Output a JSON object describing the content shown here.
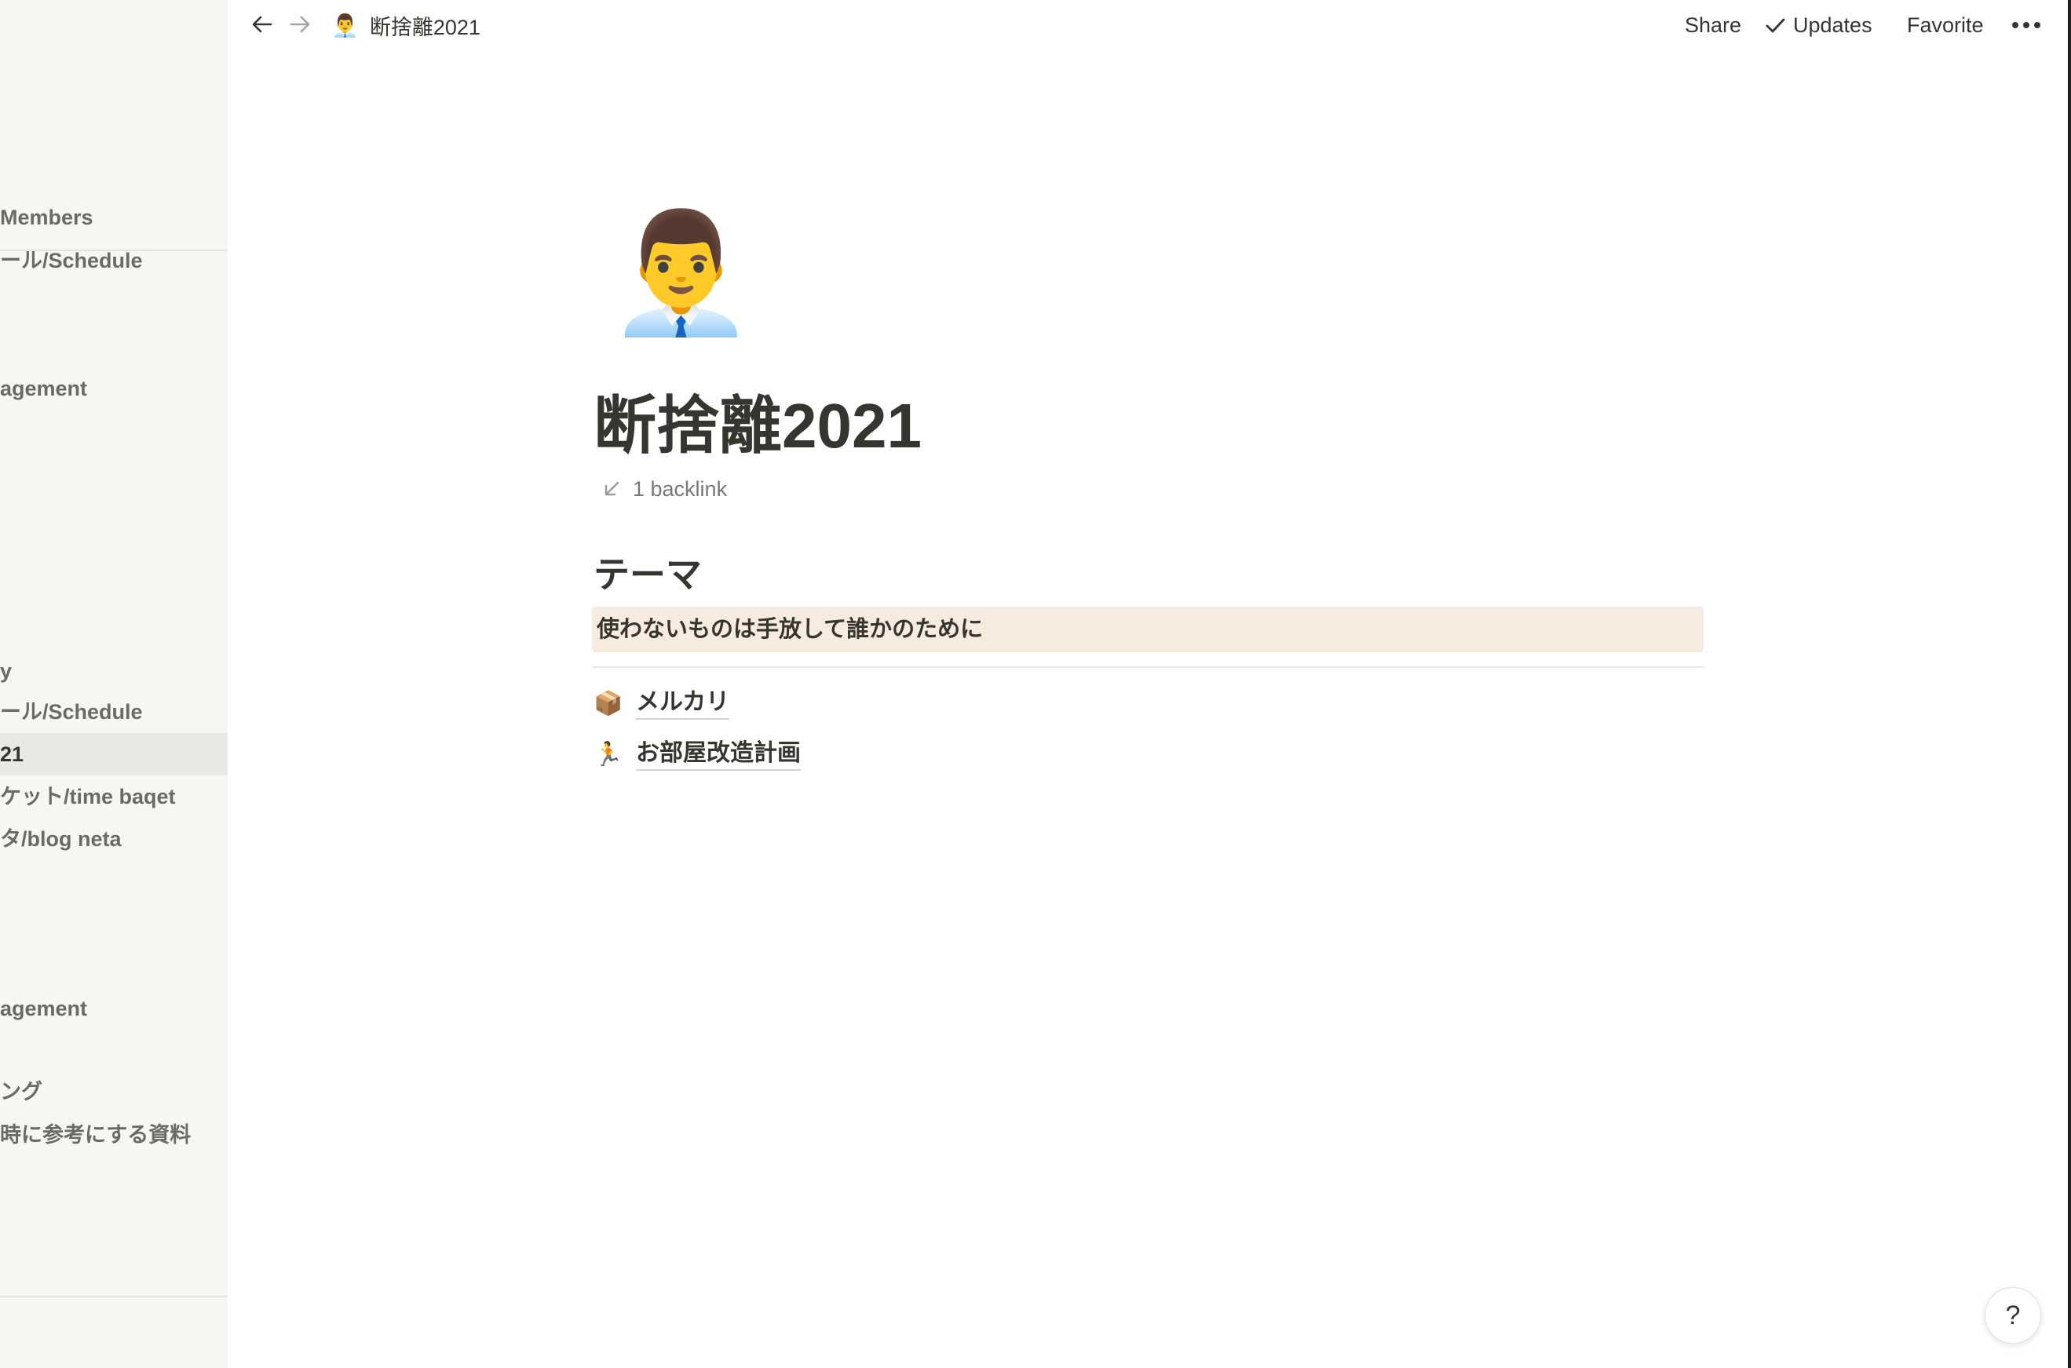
{
  "sidebar": {
    "items": [
      {
        "label": "Members"
      },
      {
        "label": "ール/Schedule"
      },
      {
        "label": "agement"
      },
      {
        "label": "y"
      },
      {
        "label": "ール/Schedule"
      },
      {
        "label": "21"
      },
      {
        "label": "ケット/time baqet"
      },
      {
        "label": "タ/blog neta"
      },
      {
        "label": "agement"
      },
      {
        "label": "ング"
      },
      {
        "label": "時に参考にする資料"
      }
    ]
  },
  "topbar": {
    "back_icon": "arrow-left-icon",
    "forward_icon": "arrow-right-icon",
    "breadcrumb_emoji": "👨‍💼",
    "breadcrumb_title": "断捨離2021",
    "share_label": "Share",
    "updates_label": "Updates",
    "favorite_label": "Favorite",
    "more_icon": "ellipsis-icon"
  },
  "page": {
    "icon": "👨‍💼",
    "title": "断捨離2021",
    "backlink_label": "1 backlink",
    "heading": "テーマ",
    "callout_text": "使わないものは手放して誰かのために",
    "links": [
      {
        "emoji": "📦",
        "label": "メルカリ"
      },
      {
        "emoji": "🏃",
        "label": "お部屋改造計画"
      }
    ]
  },
  "help": {
    "label": "?"
  },
  "colors": {
    "sidebar_bg": "#f7f6f3",
    "sidebar_active_bg": "#e9e8e4",
    "callout_bg": "#f7ebe0",
    "text": "#37352f",
    "muted_text": "#787774"
  }
}
